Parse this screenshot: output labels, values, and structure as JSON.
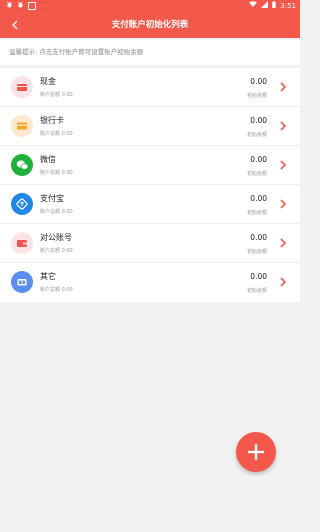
{
  "status_bar": {
    "left_icons": [
      "bug-icon",
      "bug-icon",
      "notification-icon"
    ],
    "time": "3:51"
  },
  "app_bar": {
    "title": "支付账户初始化列表"
  },
  "tip": {
    "text": "温馨提示: 点击支付账户即可设置账户初始余额"
  },
  "accounts": [
    {
      "name": "现金",
      "subtitle": "账户总额 0.00",
      "amount": "0.00",
      "amount_label": "初始余额",
      "icon": "cash-icon",
      "icon_bg": "#fde3e3",
      "icon_fg": "#ef5350"
    },
    {
      "name": "银行卡",
      "subtitle": "账户总额 0.00",
      "amount": "0.00",
      "amount_label": "初始余额",
      "icon": "bank-card-icon",
      "icon_bg": "#fde8cc",
      "icon_fg": "#f6a623"
    },
    {
      "name": "微信",
      "subtitle": "账户总额 0.00",
      "amount": "0.00",
      "amount_label": "初始余额",
      "icon": "wechat-icon",
      "icon_bg": "#1fb23a",
      "icon_fg": "#ffffff"
    },
    {
      "name": "支付宝",
      "subtitle": "账户总额 0.00",
      "amount": "0.00",
      "amount_label": "初始余额",
      "icon": "alipay-icon",
      "icon_bg": "#1e88e5",
      "icon_fg": "#ffffff"
    },
    {
      "name": "对公账号",
      "subtitle": "账户总额 0.00",
      "amount": "0.00",
      "amount_label": "初始余额",
      "icon": "wallet-icon",
      "icon_bg": "#fde3e3",
      "icon_fg": "#ef5350"
    },
    {
      "name": "其它",
      "subtitle": "账户总额 0.00",
      "amount": "0.00",
      "amount_label": "初始余额",
      "icon": "other-icon",
      "icon_bg": "#5b8def",
      "icon_fg": "#ffffff"
    }
  ],
  "fab": {
    "icon": "plus-icon"
  },
  "colors": {
    "primary": "#f4584a",
    "background": "#f2f2f2"
  }
}
